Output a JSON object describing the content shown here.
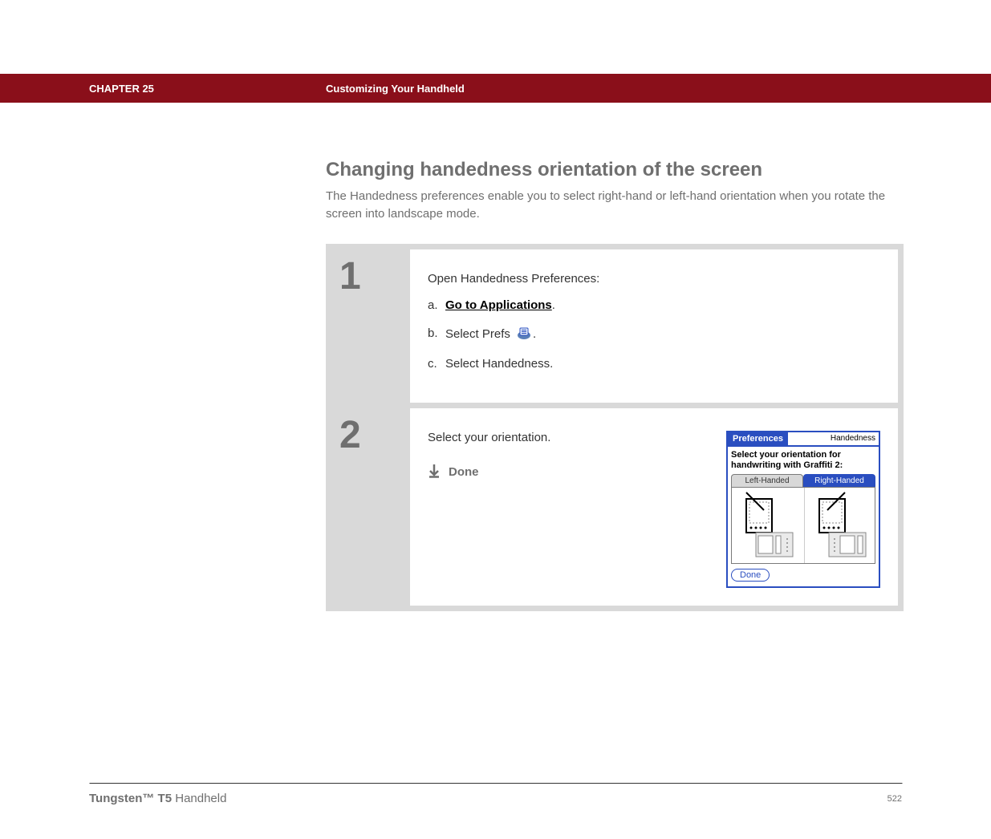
{
  "header": {
    "chapter": "CHAPTER 25",
    "section": "Customizing Your Handheld"
  },
  "main": {
    "heading": "Changing handedness orientation of the screen",
    "intro": "The Handedness preferences enable you to select right-hand or left-hand orientation when you rotate the screen into landscape mode."
  },
  "steps": [
    {
      "num": "1",
      "lead": "Open Handedness Preferences:",
      "items": [
        {
          "letter": "a.",
          "link": "Go to Applications",
          "suffix": "."
        },
        {
          "letter": "b.",
          "prefix": "Select Prefs ",
          "icon": "prefs",
          "suffix": "."
        },
        {
          "letter": "c.",
          "text": "Select Handedness."
        }
      ]
    },
    {
      "num": "2",
      "lead": "Select your orientation.",
      "done": "Done"
    }
  ],
  "palm": {
    "title_left": "Preferences",
    "title_right": "Handedness",
    "prompt_line1": "Select your orientation for",
    "prompt_line2": "handwriting with Graffiti 2:",
    "tab_left": "Left-Handed",
    "tab_right": "Right-Handed",
    "done_btn": "Done"
  },
  "footer": {
    "product_bold": "Tungsten™ T5",
    "product_rest": " Handheld",
    "page": "522"
  }
}
